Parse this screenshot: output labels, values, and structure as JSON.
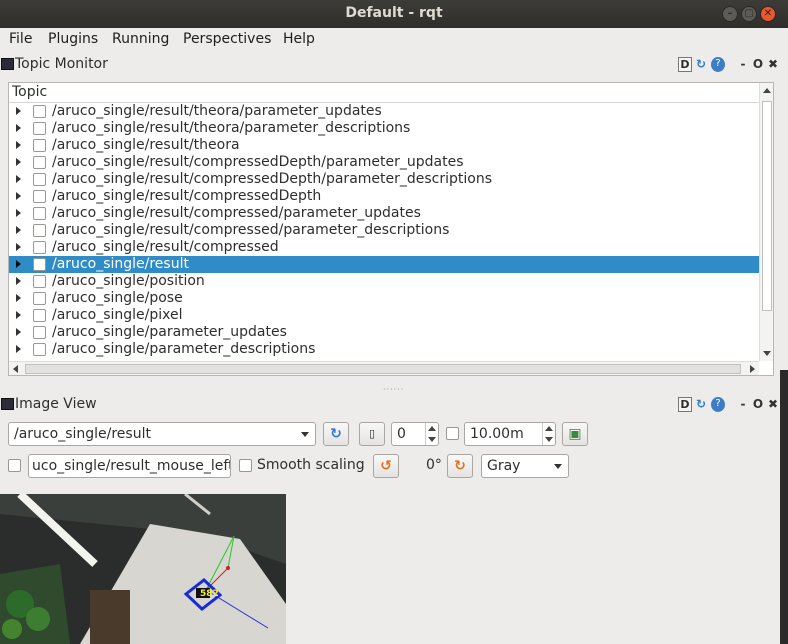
{
  "window": {
    "title": "Default - rqt"
  },
  "menus": [
    "File",
    "Plugins",
    "Running",
    "Perspectives",
    "Help"
  ],
  "topic_monitor": {
    "title": "Topic Monitor",
    "column_header": "Topic",
    "rows": [
      "/aruco_single/result/theora/parameter_updates",
      "/aruco_single/result/theora/parameter_descriptions",
      "/aruco_single/result/theora",
      "/aruco_single/result/compressedDepth/parameter_updates",
      "/aruco_single/result/compressedDepth/parameter_descriptions",
      "/aruco_single/result/compressedDepth",
      "/aruco_single/result/compressed/parameter_updates",
      "/aruco_single/result/compressed/parameter_descriptions",
      "/aruco_single/result/compressed",
      "/aruco_single/result",
      "/aruco_single/position",
      "/aruco_single/pose",
      "/aruco_single/pixel",
      "/aruco_single/parameter_updates",
      "/aruco_single/parameter_descriptions"
    ],
    "selected_index": 9
  },
  "panel_buttons": {
    "d": "D",
    "minus": "-",
    "o": "O",
    "x": "✖",
    "help": "?",
    "reload": "↻"
  },
  "image_view": {
    "title": "Image View",
    "topic": "/aruco_single/result",
    "spin_value": "0",
    "zoom_value": "10.00m",
    "mouse_topic": "uco_single/result_mouse_left",
    "smooth_label": "Smooth scaling",
    "rotation": "0°",
    "colormap": "Gray",
    "marker_label": "582"
  }
}
